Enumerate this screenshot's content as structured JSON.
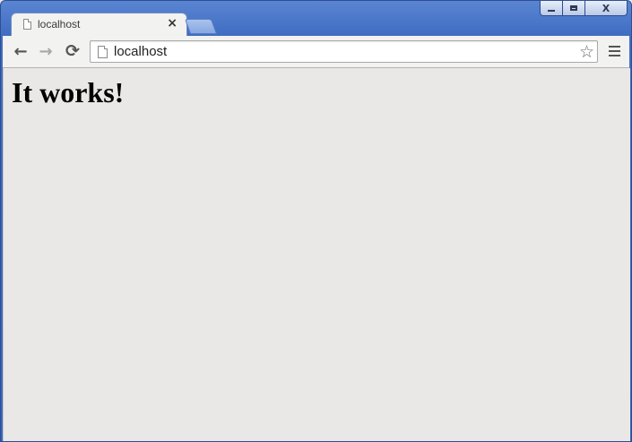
{
  "window": {
    "controls": {
      "minimize_icon": "minimize-icon",
      "maximize_icon": "maximize-icon",
      "close_label": "X"
    }
  },
  "tabs": [
    {
      "title": "localhost",
      "close_label": "×",
      "active": true
    }
  ],
  "toolbar": {
    "back_icon": "←",
    "forward_icon": "→",
    "reload_icon": "⟳",
    "address": "localhost",
    "bookmark_icon": "☆"
  },
  "page": {
    "heading": "It works!"
  },
  "colors": {
    "frame": "#3f6cc1",
    "toolbar": "#f2f2f1",
    "content_bg": "#eae8e6"
  }
}
